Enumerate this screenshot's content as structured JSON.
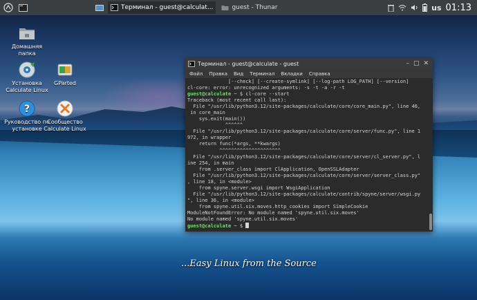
{
  "panel": {
    "tasks": [
      {
        "label": "Терминал - guest@calculat..."
      },
      {
        "label": "guest - Thunar"
      }
    ],
    "lang": "us",
    "clock": "01:13"
  },
  "desktop": {
    "icons": [
      {
        "label": "Домашняя папка"
      },
      {
        "label": "Установка Calculate Linux"
      },
      {
        "label": "GParted"
      },
      {
        "label": "Руководство по установке"
      },
      {
        "label": "Сообщество Calculate Linux"
      }
    ],
    "slogan": "...Easy Linux from the Source"
  },
  "terminal": {
    "title": "Терминал - guest@calculate - guest",
    "menu": [
      "Файл",
      "Правка",
      "Вид",
      "Терминал",
      "Вкладки",
      "Справка"
    ],
    "lines": [
      "              [--check] [--create-symlink] [--log-path LOG_PATH] [--version]",
      "cl-core: error: unrecognized arguments: -s -t -a -r -t",
      "guest@calculate ~ $ cl-core --start",
      "Traceback (most recent call last):",
      "  File \"/usr/lib/python3.12/site-packages/calculate/core/core_main.py\", line 46,",
      " in core_main",
      "    sys.exit(main())",
      "             ^^^^^^",
      "  File \"/usr/lib/python3.12/site-packages/calculate/core/server/func.py\", line 1",
      "972, in wrapper",
      "    return func(*args, **kwargs)",
      "           ^^^^^^^^^^^^^^^^^^^^^",
      "  File \"/usr/lib/python3.12/site-packages/calculate/core/server/cl_server.py\", l",
      "ine 254, in main",
      "    from .server_class import ClApplication, OpenSSLAdapter",
      "  File \"/usr/lib/python3.12/site-packages/calculate/core/server/server_class.py\"",
      ", line 18, in <module>",
      "    from spyne.server.wsgi import WsgiApplication",
      "  File \"/usr/lib/python3.12/site-packages/calculate/contrib/spyne/server/wsgi.py",
      "\", line 36, in <module>",
      "    from spyne.util.six.moves.http_cookies import SimpleCookie",
      "ModuleNotFoundError: No module named 'spyne.util.six.moves'",
      "No module named 'spyne.util.six.moves'"
    ],
    "prompt_user": "guest@calculate",
    "prompt_rest": " ~ $ ",
    "cmd_prompt_user": "guest@calculate",
    "cmd_prompt_rest": " ~ $ cl-core --start"
  }
}
